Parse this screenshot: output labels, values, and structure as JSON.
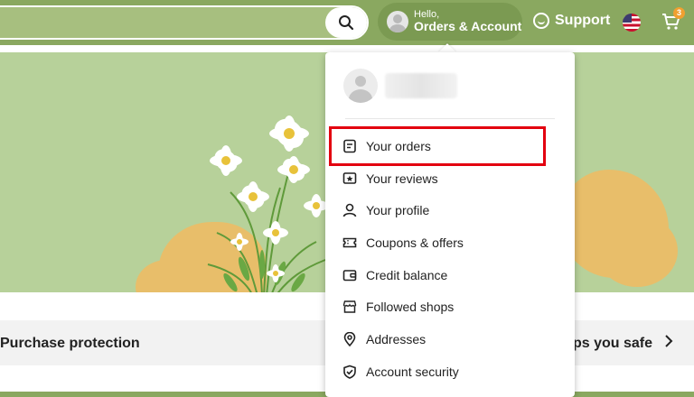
{
  "header": {
    "account": {
      "greeting": "Hello,",
      "label": "Orders & Account"
    },
    "support_label": "Support",
    "cart_count": "3",
    "icons": {
      "search": "search-icon",
      "support": "chat-bubble-icon",
      "flag": "us-flag-icon",
      "cart": "cart-icon"
    }
  },
  "account_menu": {
    "items": [
      {
        "label": "Your orders",
        "icon": "orders-doc-icon",
        "highlighted": true
      },
      {
        "label": "Your reviews",
        "icon": "review-star-icon"
      },
      {
        "label": "Your profile",
        "icon": "person-icon"
      },
      {
        "label": "Coupons & offers",
        "icon": "ticket-icon"
      },
      {
        "label": "Credit balance",
        "icon": "wallet-icon"
      },
      {
        "label": "Followed shops",
        "icon": "shop-icon"
      },
      {
        "label": "Addresses",
        "icon": "location-pin-icon"
      },
      {
        "label": "Account security",
        "icon": "shield-icon"
      }
    ]
  },
  "promo": {
    "left_text": "Purchase protection",
    "right_text": "ps you safe"
  },
  "colors": {
    "header_bg": "#8aa860",
    "hero_bg": "#b7d19a",
    "highlight": "#e3000f",
    "badge": "#f0a030"
  }
}
